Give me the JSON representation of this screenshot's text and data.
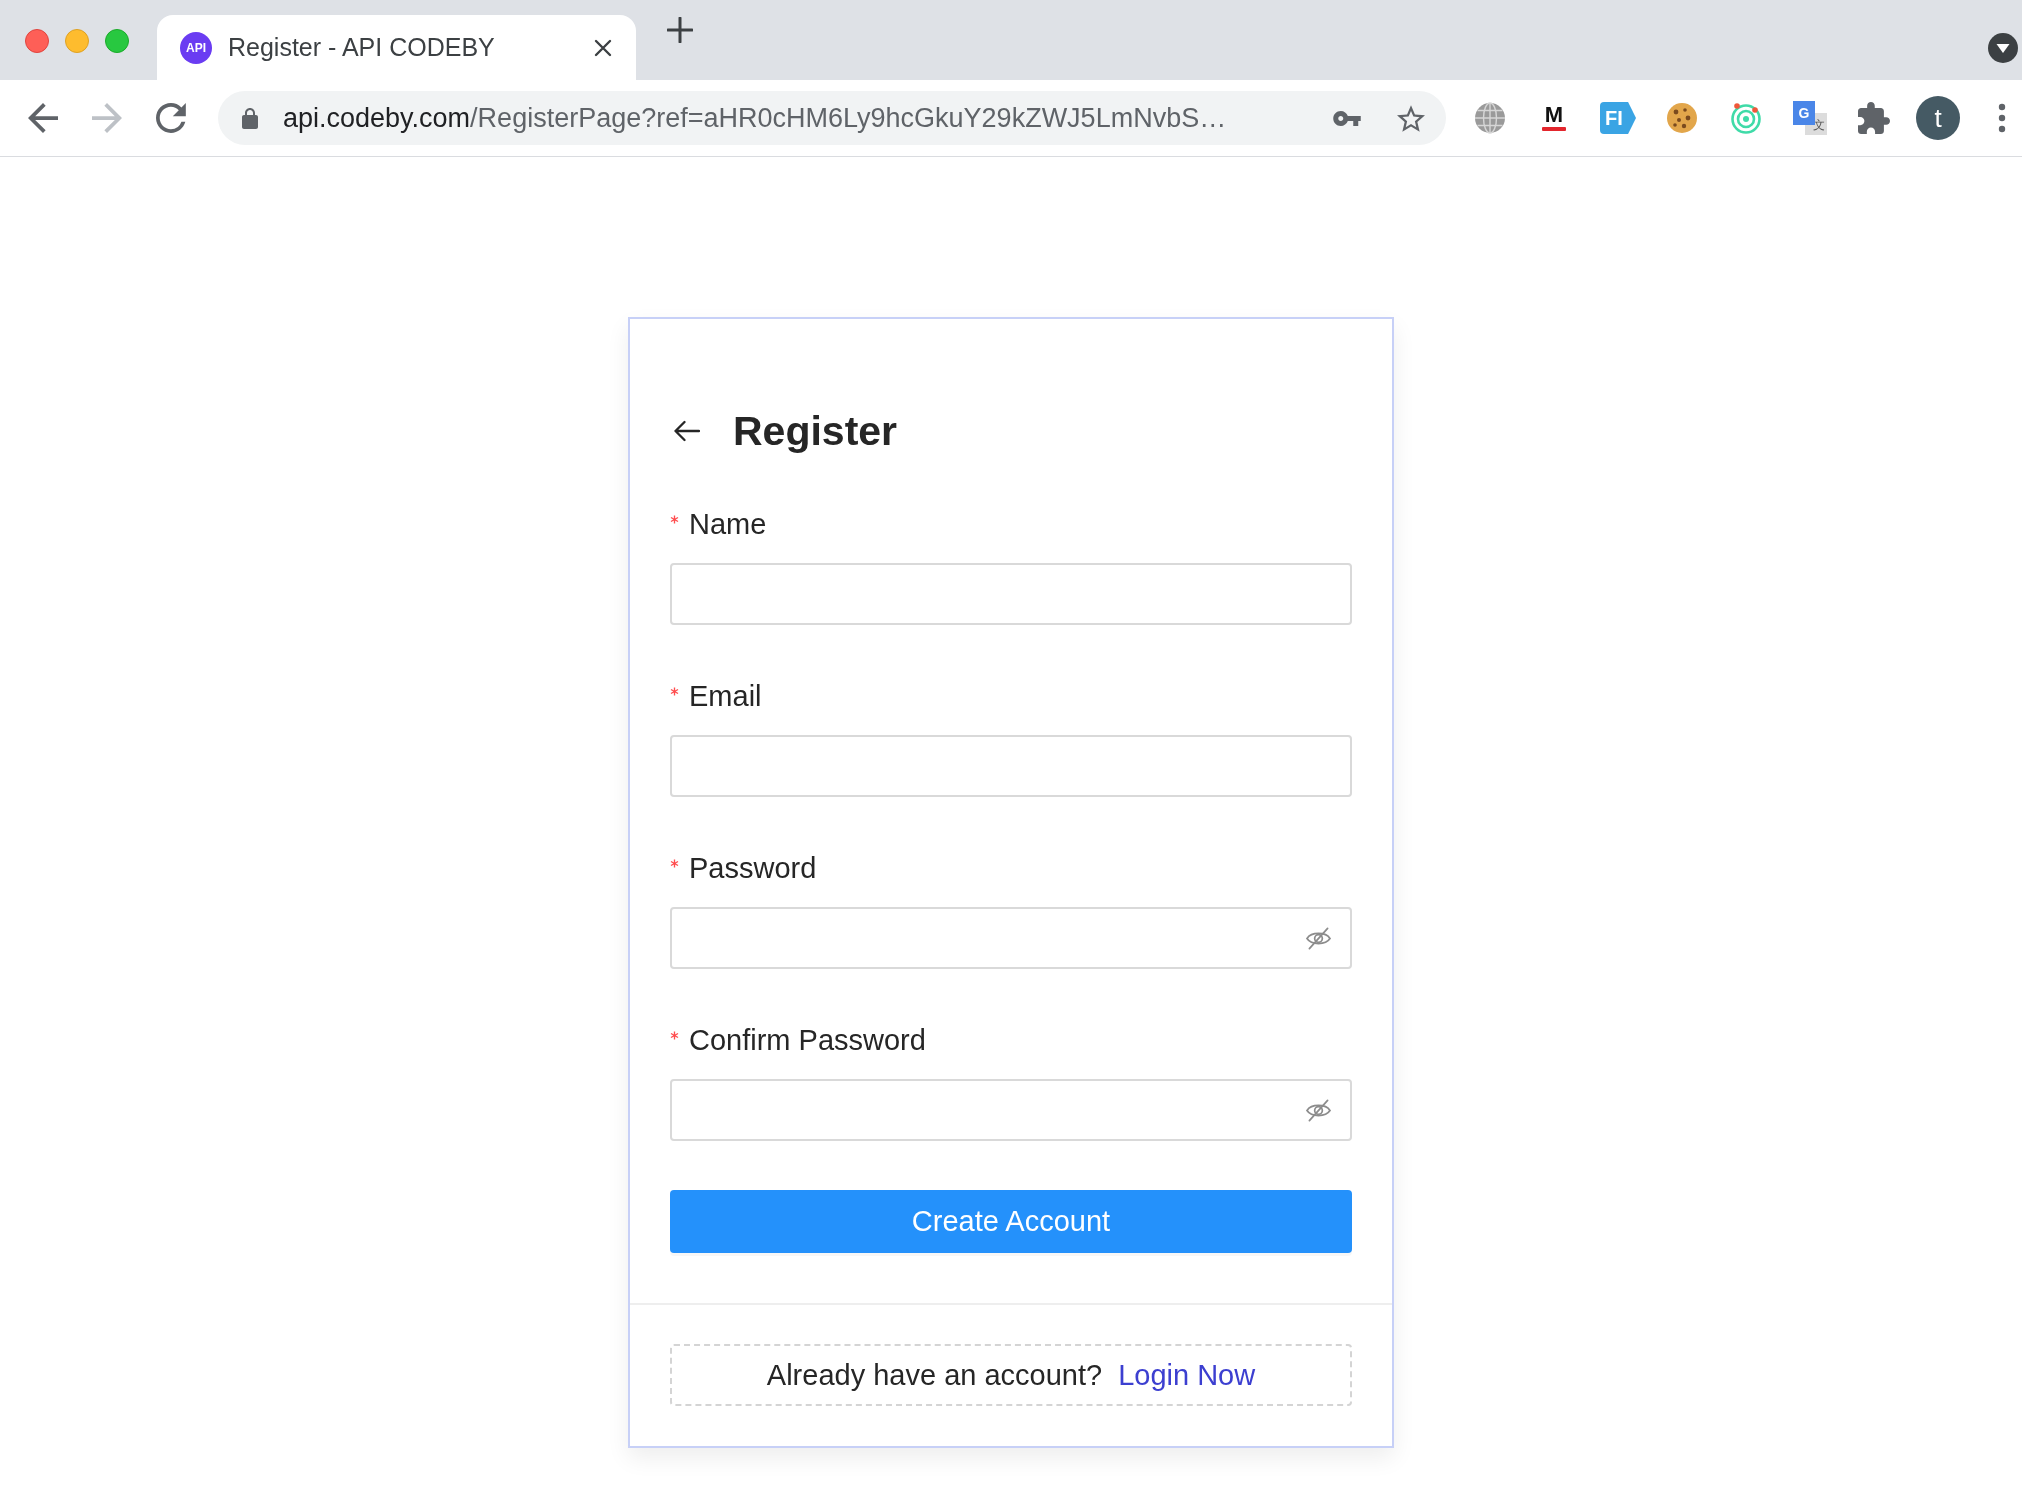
{
  "browser": {
    "tab": {
      "favicon_text": "API",
      "title": "Register - API CODEBY"
    },
    "nav_buttons": [
      {
        "kind": "back",
        "disabled": false
      },
      {
        "kind": "forward",
        "disabled": true
      },
      {
        "kind": "reload",
        "disabled": false
      }
    ],
    "address_bar": {
      "host": "api.codeby.com",
      "path": "/RegisterPage?ref=aHR0cHM6Ly9hcGkuY29kZWJ5LmNvbS…"
    },
    "extensions": [
      {
        "kind": "globe"
      },
      {
        "kind": "letter",
        "labels": [
          "M"
        ]
      },
      {
        "kind": "tag",
        "labels": [
          "FI"
        ]
      },
      {
        "kind": "cookie"
      },
      {
        "kind": "target"
      },
      {
        "kind": "translate",
        "labels": [
          "G",
          "文"
        ]
      },
      {
        "kind": "puzzle"
      }
    ],
    "profile": {
      "initial": "t"
    }
  },
  "form": {
    "title": "Register",
    "fields": [
      {
        "label": "Name",
        "required": true,
        "kind": "text"
      },
      {
        "label": "Email",
        "required": true,
        "kind": "text"
      },
      {
        "label": "Password",
        "required": true,
        "kind": "password"
      },
      {
        "label": "Confirm Password",
        "required": true,
        "kind": "password"
      }
    ],
    "submit": "Create Account",
    "footer": {
      "text": "Already have an account?",
      "link": "Login Now"
    }
  }
}
